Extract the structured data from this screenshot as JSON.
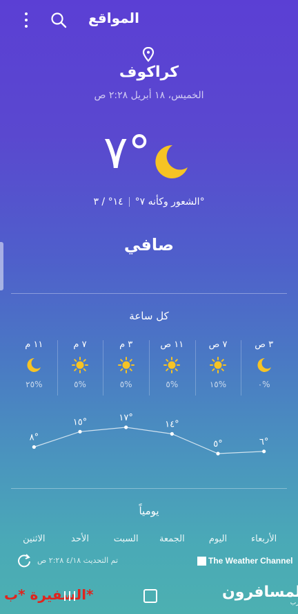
{
  "header": {
    "title": "المواقع",
    "icons": [
      "more-vert-icon",
      "search-icon"
    ]
  },
  "location": {
    "city": "كراكوف",
    "datetime": "الخميس، ١٨ أبريل ٢:٢٨ ص"
  },
  "current": {
    "temperature": "٧°",
    "icon": "moon-icon",
    "high_low": "١٤° / ٣°",
    "feels_like": "الشعور وكأنه ٧°",
    "condition": "صافي"
  },
  "hourly": {
    "title": "كل ساعة",
    "items": [
      {
        "time": "٣ ص",
        "icon": "moon-icon",
        "precip": "٠%",
        "temp": "٦°",
        "value": 6
      },
      {
        "time": "٧ ص",
        "icon": "sun-icon",
        "precip": "١٥%",
        "temp": "٥°",
        "value": 5
      },
      {
        "time": "١١ ص",
        "icon": "sun-icon",
        "precip": "٥%",
        "temp": "١٤°",
        "value": 14
      },
      {
        "time": "٣ م",
        "icon": "sun-icon",
        "precip": "٥%",
        "temp": "١٧°",
        "value": 17
      },
      {
        "time": "٧ م",
        "icon": "sun-icon",
        "precip": "٥%",
        "temp": "١٥°",
        "value": 15
      },
      {
        "time": "١١ م",
        "icon": "moon-icon",
        "precip": "٢٥%",
        "temp": "٨°",
        "value": 8
      }
    ]
  },
  "daily": {
    "title": "يومياً",
    "days": [
      "الأربعاء",
      "اليوم",
      "الجمعة",
      "السبت",
      "الأحد",
      "الاثنين"
    ]
  },
  "footer": {
    "provider": "The Weather Channel",
    "updated": "تم التحديث ٤/١٨ ٢:٢٨ ص"
  },
  "watermark": {
    "left": "السفيرة *ب*",
    "right": "المسافرون",
    "right_small": "العرب"
  },
  "colors": {
    "background_top": "#5b3fd4",
    "background_bottom": "#4cb0b1",
    "moon": "#f6c324",
    "sun": "#f6c324",
    "watermark_red": "#e0241e"
  }
}
